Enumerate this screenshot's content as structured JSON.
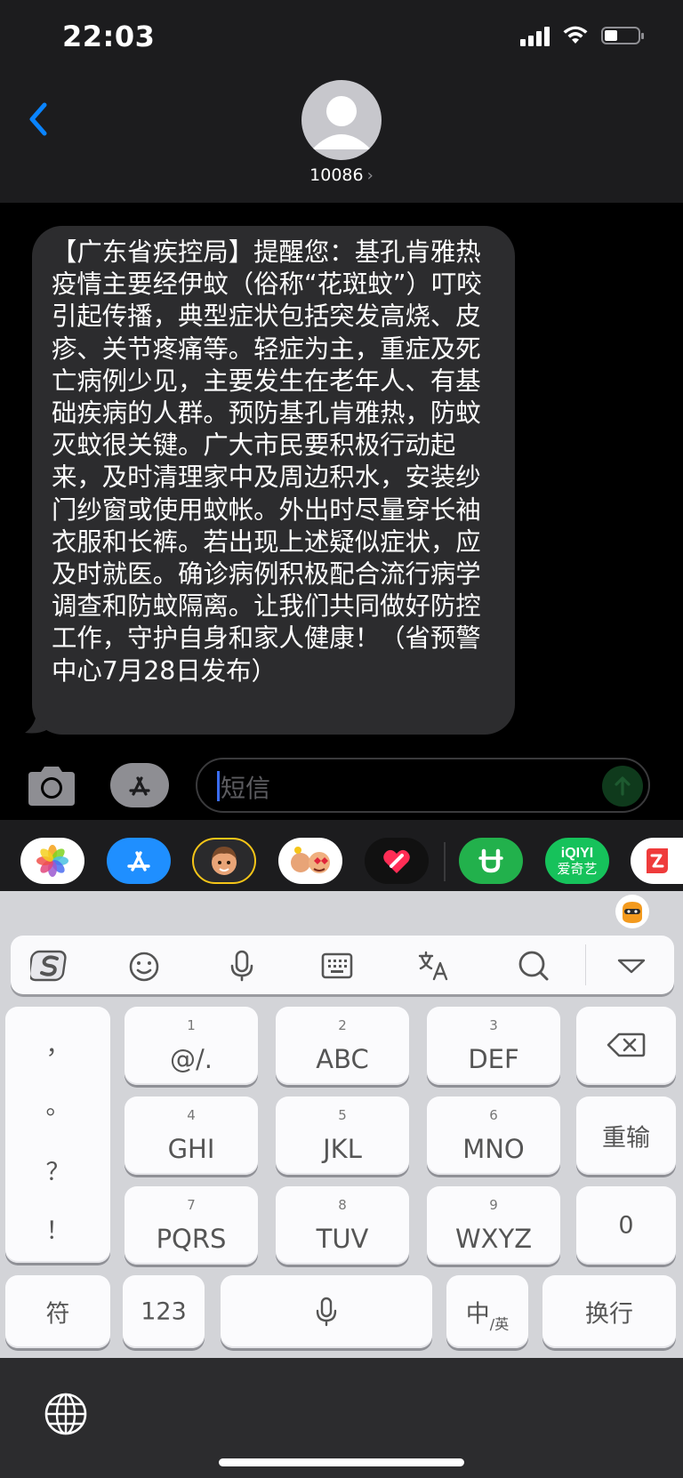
{
  "status_bar": {
    "time": "22:03",
    "icons": [
      "signal-icon",
      "wifi-icon",
      "battery-icon"
    ]
  },
  "header": {
    "back_icon": "chevron-left-icon",
    "contact": "10086",
    "contact_chevron": "›"
  },
  "message": {
    "text": "【广东省疾控局】提醒您：基孔肯雅热疫情主要经伊蚊（俗称“花斑蚊”）叮咬引起传播，典型症状包括突发高烧、皮疹、关节疼痛等。轻症为主，重症及死亡病例少见，主要发生在老年人、有基础疾病的人群。预防基孔肯雅热，防蚊灭蚊很关键。广大市民要积极行动起来，及时清理家中及周边积水，安装纱门纱窗或使用蚊帐。外出时尽量穿长袖衣服和长裤。若出现上述疑似症状，应及时就医。确诊病例积极配合流行病学调查和防蚊隔离。让我们共同做好防控工作，守护自身和家人健康！（省预警中心7月28日发布）"
  },
  "composer": {
    "placeholder": "短信",
    "camera_icon": "camera-icon",
    "apps_icon": "app-store-icon",
    "send_icon": "send-arrow-icon"
  },
  "app_strip": {
    "apps": [
      {
        "name": "photos-app-icon"
      },
      {
        "name": "app-store-app-icon"
      },
      {
        "name": "memoji-app-icon"
      },
      {
        "name": "animoji-app-icon"
      },
      {
        "name": "digital-touch-app-icon"
      },
      {
        "name": "green-app-icon"
      },
      {
        "name": "iqiyi-app-icon",
        "label_top": "iQIYI",
        "label_bottom": "爱奇艺"
      },
      {
        "name": "red-app-icon"
      }
    ]
  },
  "keyboard": {
    "toolbar_icons": [
      "sogou-logo-icon",
      "emoji-icon",
      "microphone-icon",
      "keyboard-icon",
      "translate-icon",
      "search-icon",
      "collapse-icon"
    ],
    "punctuation": [
      "，",
      "。",
      "？",
      "！"
    ],
    "keys": [
      {
        "num": "1",
        "label": "@/."
      },
      {
        "num": "2",
        "label": "ABC"
      },
      {
        "num": "3",
        "label": "DEF"
      },
      {
        "num": "4",
        "label": "GHI"
      },
      {
        "num": "5",
        "label": "JKL"
      },
      {
        "num": "6",
        "label": "MNO"
      },
      {
        "num": "7",
        "label": "PQRS"
      },
      {
        "num": "8",
        "label": "TUV"
      },
      {
        "num": "9",
        "label": "WXYZ"
      }
    ],
    "retype": "重输",
    "zero": "0",
    "symbol": "符",
    "numeric": "123",
    "lang_main": "中",
    "lang_sub": "/英",
    "enter": "换行"
  },
  "colors": {
    "header_bg": "#1c1c1e",
    "bubble_bg": "#2c2c2e",
    "accent_blue": "#0a84ff",
    "keyboard_bg": "#d3d4d8"
  }
}
